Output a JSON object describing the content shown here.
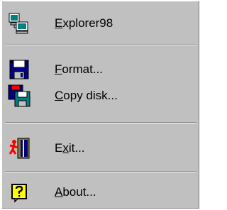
{
  "menu": {
    "items": [
      {
        "label": "Explorer98",
        "mnemonic_index": 0,
        "icon": "explorer-computer-icon"
      },
      {
        "label": "Format...",
        "mnemonic_index": 0,
        "icon": "floppy-disk-icon"
      },
      {
        "label": "Copy disk...",
        "mnemonic_index": 0,
        "icon": "copy-disk-icon"
      },
      {
        "label": "Exit...",
        "mnemonic_index": 1,
        "icon": "exit-door-icon"
      },
      {
        "label": "About...",
        "mnemonic_index": 0,
        "icon": "question-help-icon"
      }
    ]
  },
  "colors": {
    "face": "#c0c0c0",
    "shadow": "#808080",
    "highlight": "#ffffff"
  }
}
